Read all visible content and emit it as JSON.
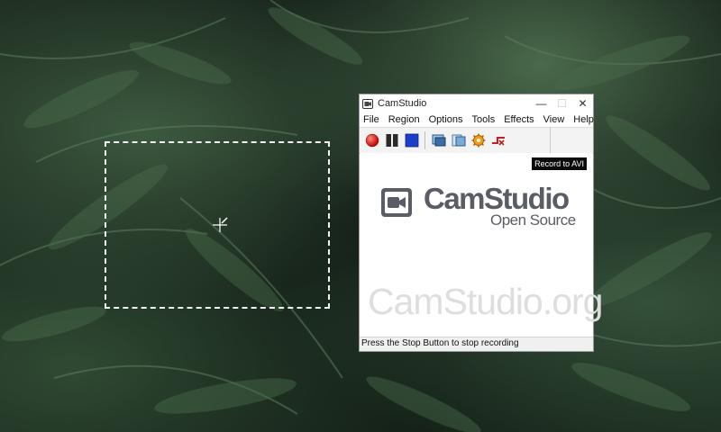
{
  "window": {
    "title": "CamStudio",
    "controls": {
      "minimize": "—",
      "maximize": "☐",
      "close": "✕"
    }
  },
  "menu": [
    "File",
    "Region",
    "Options",
    "Tools",
    "Effects",
    "View",
    "Help"
  ],
  "toolbar": {
    "buttons": [
      {
        "name": "record-icon",
        "color": "#e01010"
      },
      {
        "name": "pause-icon",
        "color": "#222222"
      },
      {
        "name": "stop-icon",
        "color": "#1a3fc8"
      },
      {
        "name": "annotation-icon",
        "color": "#3a6ea5"
      },
      {
        "name": "video-options-icon",
        "color": "#5a8fc0"
      },
      {
        "name": "settings-icon",
        "color": "#e08a10"
      },
      {
        "name": "region-icon",
        "color": "#c81e1e"
      }
    ]
  },
  "content": {
    "record_badge": "Record to AVI",
    "logo_name": "CamStudio",
    "logo_sub": "Open Source",
    "site": "CamStudio.org"
  },
  "status": {
    "text": "Press the Stop Button to stop recording"
  },
  "colors": {
    "region_border": "#f2f2f2",
    "logo_text": "#5a5c66",
    "site_text": "#dedede"
  }
}
